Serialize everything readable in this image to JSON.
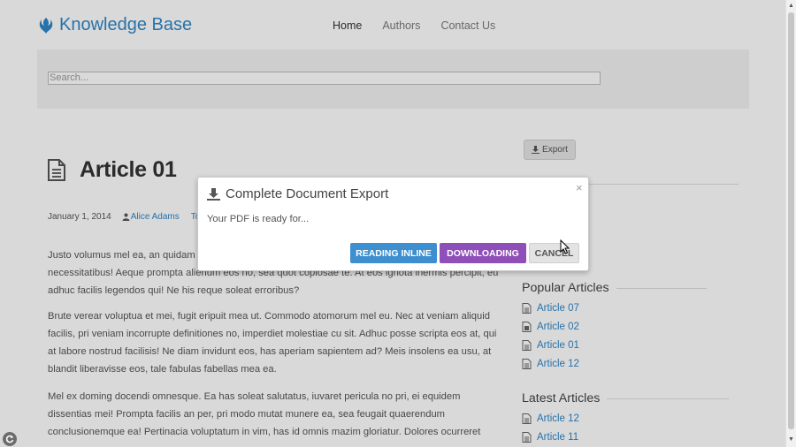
{
  "header": {
    "brand": "Knowledge Base",
    "nav": [
      {
        "label": "Home",
        "active": true
      },
      {
        "label": "Authors",
        "active": false
      },
      {
        "label": "Contact Us",
        "active": false
      }
    ]
  },
  "search": {
    "placeholder": "Search..."
  },
  "article": {
    "title": "Article 01",
    "date": "January 1, 2014",
    "author": "Alice Adams",
    "tag": "To",
    "paragraphs": [
      "Justo volumus mel ea, an quidam definitionem ius. Per ex debet viderer necessitatibus, pertinax necessitatibus! Aeque prompta alienum eos no, sea quot copiosae te. At eos ignota inermis percipit, eu adhuc facilis legendos qui! Ne his reque soleat erroribus?",
      "Brute verear voluptua et mei, fugit eripuit mea ut. Commodo atomorum mel eu. Nec at veniam aliquid facilis, pri veniam incorrupte definitiones no, imperdiet molestiae cu sit. Adhuc posse scripta eos at, qui at labore nostrud facilisis! Ne diam invidunt eos, has aperiam sapientem ad? Meis insolens ea usu, at blandit liberavisse eos, tale fabulas fabellas mea ea.",
      "Mel ex doming docendi omnesque. Ea has soleat salutatus, iuvaret pericula no pri, ei equidem dissentias mei! Prompta facilis an per, pri modo mutat munere ea, sea feugait quaerendum conclusionemque ea! Pertinacia voluptatum in vim, has id omnis mazim gloriatur. Dolores ocurreret"
    ]
  },
  "sidebar": {
    "export_label": "Export",
    "popular_heading": "Popular Articles",
    "popular": [
      "Article 07",
      "Article 02",
      "Article 01",
      "Article 12"
    ],
    "latest_heading": "Latest Articles",
    "latest": [
      "Article 12",
      "Article 11"
    ]
  },
  "modal": {
    "title": "Complete Document Export",
    "body": "Your PDF is ready for...",
    "close": "×",
    "buttons": {
      "inline": "READING INLINE",
      "download": "DOWNLOADING",
      "cancel": "CANCEL"
    }
  },
  "colors": {
    "brand": "#2f87c8",
    "inline_button": "#3d8fd0",
    "download_button": "#8e4fb8"
  }
}
